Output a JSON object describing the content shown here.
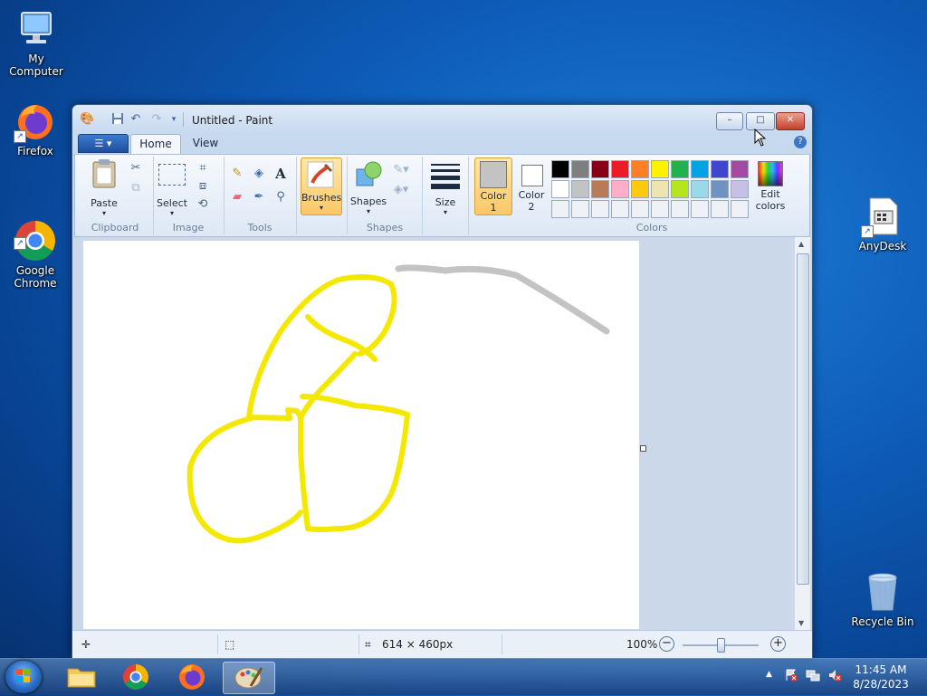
{
  "desktop": {
    "icons": [
      {
        "label": "My Computer"
      },
      {
        "label": "Firefox"
      },
      {
        "label": "Google\nChrome"
      },
      {
        "label": "AnyDesk"
      },
      {
        "label": "Recycle Bin"
      }
    ]
  },
  "window": {
    "title": "Untitled - Paint",
    "tabs": {
      "home": "Home",
      "view": "View"
    },
    "help": "?",
    "controls": {
      "minimize": "–",
      "maximize": "□",
      "close": "✕"
    }
  },
  "ribbon": {
    "clipboard": {
      "paste": "Paste",
      "group": "Clipboard"
    },
    "image": {
      "select": "Select",
      "group": "Image"
    },
    "tools": {
      "group": "Tools",
      "text_tool": "A"
    },
    "brushes": {
      "label": "Brushes"
    },
    "shapes": {
      "label": "Shapes",
      "group": "Shapes"
    },
    "size": {
      "label": "Size"
    },
    "color1": {
      "label": "Color",
      "num": "1",
      "value": "#c3c3c3"
    },
    "color2": {
      "label": "Color",
      "num": "2",
      "value": "#ffffff"
    },
    "colors_group": "Colors",
    "edit_colors": {
      "line1": "Edit",
      "line2": "colors"
    },
    "palette_row1": [
      "#000000",
      "#7f7f7f",
      "#880015",
      "#ed1c24",
      "#ff7f27",
      "#fff200",
      "#22b14c",
      "#00a2e8",
      "#3f48cc",
      "#a349a4"
    ],
    "palette_row2": [
      "#ffffff",
      "#c3c3c3",
      "#b97a57",
      "#ffaec9",
      "#ffc90e",
      "#efe4b0",
      "#b5e61d",
      "#99d9ea",
      "#7092be",
      "#c8bfe7"
    ]
  },
  "status": {
    "image_size": "614 × 460px",
    "zoom": "100%",
    "zoom_level": 0.5
  },
  "taskbar": {
    "time": "11:45 AM",
    "date": "8/28/2023"
  },
  "colors": {
    "stroke_yellow": "#f5e800",
    "stroke_gray": "#c3c3c3"
  }
}
